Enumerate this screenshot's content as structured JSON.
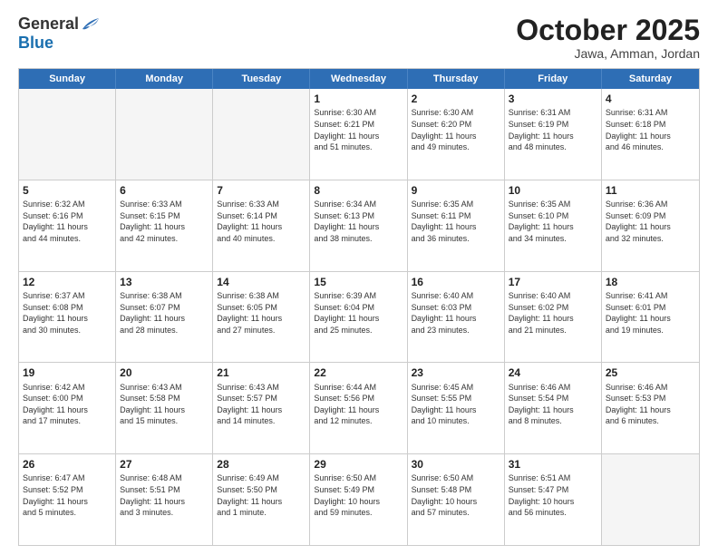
{
  "logo": {
    "general": "General",
    "blue": "Blue"
  },
  "title": "October 2025",
  "subtitle": "Jawa, Amman, Jordan",
  "header_days": [
    "Sunday",
    "Monday",
    "Tuesday",
    "Wednesday",
    "Thursday",
    "Friday",
    "Saturday"
  ],
  "weeks": [
    [
      {
        "day": "",
        "info": "",
        "empty": true
      },
      {
        "day": "",
        "info": "",
        "empty": true
      },
      {
        "day": "",
        "info": "",
        "empty": true
      },
      {
        "day": "1",
        "info": "Sunrise: 6:30 AM\nSunset: 6:21 PM\nDaylight: 11 hours\nand 51 minutes."
      },
      {
        "day": "2",
        "info": "Sunrise: 6:30 AM\nSunset: 6:20 PM\nDaylight: 11 hours\nand 49 minutes."
      },
      {
        "day": "3",
        "info": "Sunrise: 6:31 AM\nSunset: 6:19 PM\nDaylight: 11 hours\nand 48 minutes."
      },
      {
        "day": "4",
        "info": "Sunrise: 6:31 AM\nSunset: 6:18 PM\nDaylight: 11 hours\nand 46 minutes."
      }
    ],
    [
      {
        "day": "5",
        "info": "Sunrise: 6:32 AM\nSunset: 6:16 PM\nDaylight: 11 hours\nand 44 minutes."
      },
      {
        "day": "6",
        "info": "Sunrise: 6:33 AM\nSunset: 6:15 PM\nDaylight: 11 hours\nand 42 minutes."
      },
      {
        "day": "7",
        "info": "Sunrise: 6:33 AM\nSunset: 6:14 PM\nDaylight: 11 hours\nand 40 minutes."
      },
      {
        "day": "8",
        "info": "Sunrise: 6:34 AM\nSunset: 6:13 PM\nDaylight: 11 hours\nand 38 minutes."
      },
      {
        "day": "9",
        "info": "Sunrise: 6:35 AM\nSunset: 6:11 PM\nDaylight: 11 hours\nand 36 minutes."
      },
      {
        "day": "10",
        "info": "Sunrise: 6:35 AM\nSunset: 6:10 PM\nDaylight: 11 hours\nand 34 minutes."
      },
      {
        "day": "11",
        "info": "Sunrise: 6:36 AM\nSunset: 6:09 PM\nDaylight: 11 hours\nand 32 minutes."
      }
    ],
    [
      {
        "day": "12",
        "info": "Sunrise: 6:37 AM\nSunset: 6:08 PM\nDaylight: 11 hours\nand 30 minutes."
      },
      {
        "day": "13",
        "info": "Sunrise: 6:38 AM\nSunset: 6:07 PM\nDaylight: 11 hours\nand 28 minutes."
      },
      {
        "day": "14",
        "info": "Sunrise: 6:38 AM\nSunset: 6:05 PM\nDaylight: 11 hours\nand 27 minutes."
      },
      {
        "day": "15",
        "info": "Sunrise: 6:39 AM\nSunset: 6:04 PM\nDaylight: 11 hours\nand 25 minutes."
      },
      {
        "day": "16",
        "info": "Sunrise: 6:40 AM\nSunset: 6:03 PM\nDaylight: 11 hours\nand 23 minutes."
      },
      {
        "day": "17",
        "info": "Sunrise: 6:40 AM\nSunset: 6:02 PM\nDaylight: 11 hours\nand 21 minutes."
      },
      {
        "day": "18",
        "info": "Sunrise: 6:41 AM\nSunset: 6:01 PM\nDaylight: 11 hours\nand 19 minutes."
      }
    ],
    [
      {
        "day": "19",
        "info": "Sunrise: 6:42 AM\nSunset: 6:00 PM\nDaylight: 11 hours\nand 17 minutes."
      },
      {
        "day": "20",
        "info": "Sunrise: 6:43 AM\nSunset: 5:58 PM\nDaylight: 11 hours\nand 15 minutes."
      },
      {
        "day": "21",
        "info": "Sunrise: 6:43 AM\nSunset: 5:57 PM\nDaylight: 11 hours\nand 14 minutes."
      },
      {
        "day": "22",
        "info": "Sunrise: 6:44 AM\nSunset: 5:56 PM\nDaylight: 11 hours\nand 12 minutes."
      },
      {
        "day": "23",
        "info": "Sunrise: 6:45 AM\nSunset: 5:55 PM\nDaylight: 11 hours\nand 10 minutes."
      },
      {
        "day": "24",
        "info": "Sunrise: 6:46 AM\nSunset: 5:54 PM\nDaylight: 11 hours\nand 8 minutes."
      },
      {
        "day": "25",
        "info": "Sunrise: 6:46 AM\nSunset: 5:53 PM\nDaylight: 11 hours\nand 6 minutes."
      }
    ],
    [
      {
        "day": "26",
        "info": "Sunrise: 6:47 AM\nSunset: 5:52 PM\nDaylight: 11 hours\nand 5 minutes."
      },
      {
        "day": "27",
        "info": "Sunrise: 6:48 AM\nSunset: 5:51 PM\nDaylight: 11 hours\nand 3 minutes."
      },
      {
        "day": "28",
        "info": "Sunrise: 6:49 AM\nSunset: 5:50 PM\nDaylight: 11 hours\nand 1 minute."
      },
      {
        "day": "29",
        "info": "Sunrise: 6:50 AM\nSunset: 5:49 PM\nDaylight: 10 hours\nand 59 minutes."
      },
      {
        "day": "30",
        "info": "Sunrise: 6:50 AM\nSunset: 5:48 PM\nDaylight: 10 hours\nand 57 minutes."
      },
      {
        "day": "31",
        "info": "Sunrise: 6:51 AM\nSunset: 5:47 PM\nDaylight: 10 hours\nand 56 minutes."
      },
      {
        "day": "",
        "info": "",
        "empty": true
      }
    ]
  ]
}
